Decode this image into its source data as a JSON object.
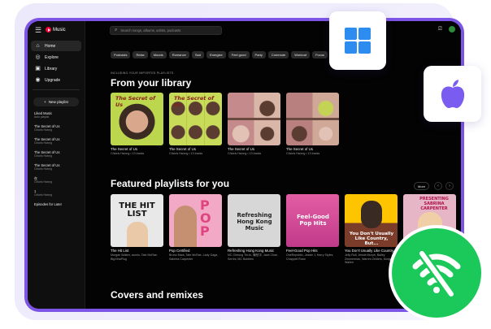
{
  "app": {
    "brand": "Music",
    "brand_color": "#ff0033",
    "accent_frame": "#7c55e6"
  },
  "sidebar": {
    "nav": [
      {
        "label": "Home",
        "icon": "home-icon",
        "active": true
      },
      {
        "label": "Explore",
        "icon": "compass-icon",
        "active": false
      },
      {
        "label": "Library",
        "icon": "library-icon",
        "active": false
      },
      {
        "label": "Upgrade",
        "icon": "upgrade-icon",
        "active": false
      }
    ],
    "new_playlist": "New playlist",
    "playlists": [
      {
        "title": "Liked Music",
        "sub": "Auto playlist"
      },
      {
        "title": "The Secret of Us",
        "sub": "Chloris Hwong"
      },
      {
        "title": "The Secret of Us",
        "sub": "Chloris Hwong"
      },
      {
        "title": "The Secret of Us",
        "sub": "Chloris Hwong"
      },
      {
        "title": "The Secret of Us",
        "sub": "Chloris Hwong"
      },
      {
        "title": "在",
        "sub": "Chloris Hwong"
      },
      {
        "title": "1",
        "sub": "Chloris Hwong"
      },
      {
        "title": "Episodes for Later",
        "sub": ""
      }
    ]
  },
  "topbar": {
    "search_placeholder": "Search songs, albums, artists, podcasts"
  },
  "chips": [
    "Podcasts",
    "Relax",
    "Moods",
    "Romance",
    "Sad",
    "Energize",
    "Feel good",
    "Party",
    "Commute",
    "Workout",
    "Focus"
  ],
  "library": {
    "kicker": "INCLUDING YOUR IMPORTED PLAYLISTS",
    "heading": "From your library",
    "cards": [
      {
        "title": "The Secret of Us",
        "sub": "Chloris Hwong • 13 tracks",
        "cover_text": "The Secret of Us"
      },
      {
        "title": "The Secret of Us",
        "sub": "Chloris Hwong • 13 tracks",
        "cover_text": "The Secret of Us"
      },
      {
        "title": "The Secret of Us",
        "sub": "Chloris Hwong • 13 tracks",
        "cover_text": ""
      },
      {
        "title": "The Secret of Us",
        "sub": "Chloris Hwong • 13 tracks",
        "cover_text": ""
      }
    ]
  },
  "featured": {
    "heading": "Featured playlists for you",
    "more": "More",
    "cards": [
      {
        "title": "The Hit List",
        "sub": "Morgan Wallen, aumlo, Tate McRae, BigXthaPlug",
        "cover_text": "THE HIT LIST"
      },
      {
        "title": "Pop Certified",
        "sub": "Bruno Mars, Tate McRae, Lady Gaga, Sabrina Carpenter",
        "cover_text": "POP"
      },
      {
        "title": "Refreshing Hong Kong Music",
        "sub": "MC Cheung Tin-fu, 陳柏宇, Jace Chan, Serrini, MC Bubbles",
        "cover_text": "Refreshing Hong Kong Music"
      },
      {
        "title": "Feel-Good Pop Hits",
        "sub": "OneRepublic, Jessie J, Harry Styles, Chappell Roan",
        "cover_text": "Feel-Good Pop Hits"
      },
      {
        "title": "You Don't Usually Like Country, But...",
        "sub": "Jelly Roll, Jessie Murph, Bailey Zimmerman, Warren Zeiders, Morgan Wallen",
        "cover_text": "You Don't Usually Like Country, But..."
      },
      {
        "title": "Presenting Sabrina Carpenter",
        "sub": "",
        "cover_text": "PRESENTING SABRINA CARPENTER"
      }
    ]
  },
  "covers": {
    "heading": "Covers and remixes"
  },
  "badges": {
    "windows_icon": "windows-logo-icon",
    "mac_icon": "apple-logo-icon",
    "offline_icon": "wifi-off-icon",
    "offline_color": "#1bc95a"
  }
}
